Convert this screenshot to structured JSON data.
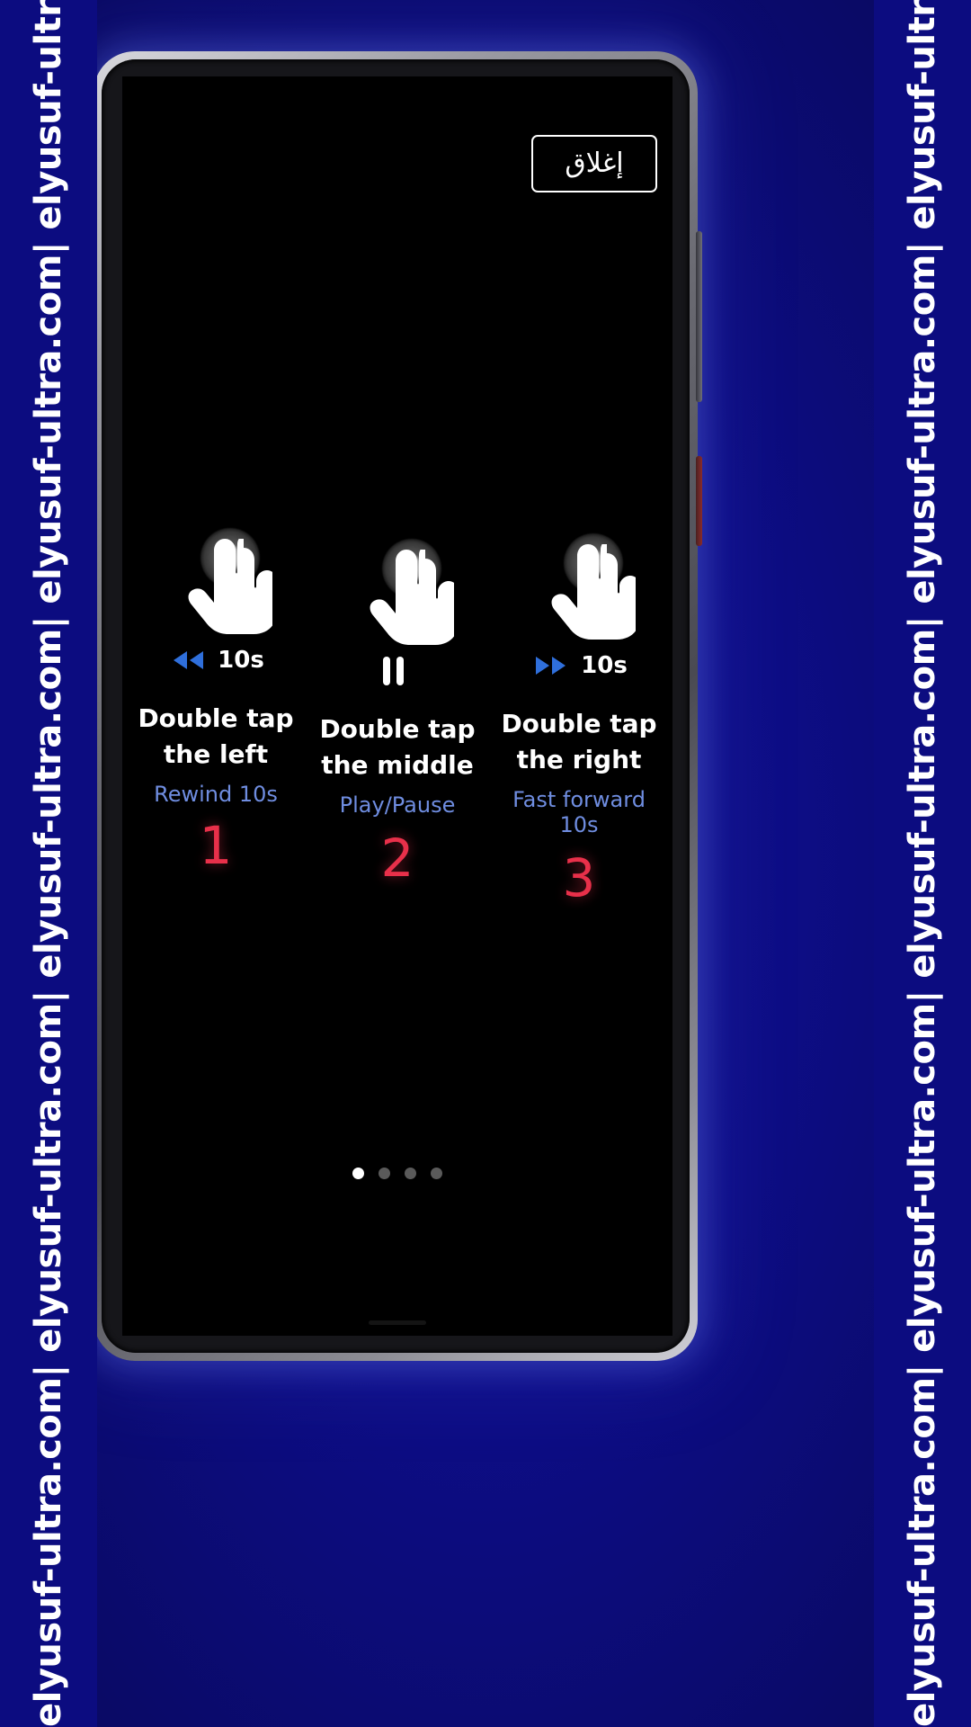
{
  "watermark": {
    "text": "elyusuf-ultra.com|  elyusuf-ultra.com|  elyusuf-ultra.com|  elyusuf-ultra.com|  elyusuf-ultra.com|  elyusuf-ultra.com|  elyusuf-ultra.com|  elyusuf-ultra.com|",
    "color": "#ffffff",
    "background": "#0c0c80"
  },
  "overlay": {
    "close_button_label": "إغلاق",
    "background_color": "#000000"
  },
  "columns": [
    {
      "icon": "hand-tap-icon",
      "action_icon": "rewind-icon",
      "action_icon_color": "#2f6fdb",
      "action_label": "10s",
      "headline": "Double tap the left",
      "subline": "Rewind 10s",
      "subline_color": "#6f8de0",
      "number": "1",
      "number_color": "#e8304a"
    },
    {
      "icon": "hand-tap-icon",
      "action_icon": "pause-icon",
      "action_icon_color": "#ffffff",
      "action_label": "",
      "headline": "Double tap the middle",
      "subline": "Play/Pause",
      "subline_color": "#6f8de0",
      "number": "2",
      "number_color": "#e8304a"
    },
    {
      "icon": "hand-tap-icon",
      "action_icon": "fast-forward-icon",
      "action_icon_color": "#2f6fdb",
      "action_label": "10s",
      "headline": "Double tap the right",
      "subline": "Fast forward 10s",
      "subline_color": "#6f8de0",
      "number": "3",
      "number_color": "#e8304a"
    }
  ],
  "pagination": {
    "total": 4,
    "active_index": 0
  }
}
